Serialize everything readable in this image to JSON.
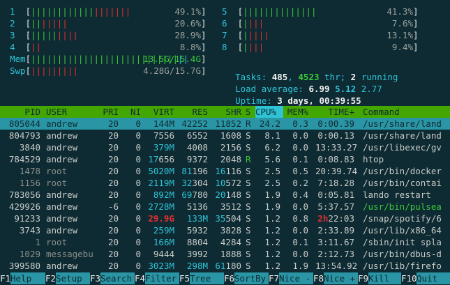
{
  "cpus": [
    {
      "id": "1",
      "pct": "49.1%",
      "bars": "|||||||||||||||||||",
      "green": 12,
      "red": 4
    },
    {
      "id": "2",
      "pct": "20.6%",
      "bars": "|||||||",
      "green": 2,
      "red": 5
    },
    {
      "id": "3",
      "pct": "28.9%",
      "bars": "|||||||||",
      "green": 5,
      "red": 4
    },
    {
      "id": "4",
      "pct": "8.8%",
      "bars": "||",
      "green": 0,
      "red": 2
    },
    {
      "id": "5",
      "pct": "41.3%",
      "bars": "||||||||||||||",
      "green": 0,
      "red": 0
    },
    {
      "id": "6",
      "pct": "7.6%",
      "bars": "||||",
      "green": 1,
      "red": 3
    },
    {
      "id": "7",
      "pct": "13.1%",
      "bars": "|||||",
      "green": 1,
      "red": 4
    },
    {
      "id": "8",
      "pct": "9.4%",
      "bars": "||||",
      "green": 1,
      "red": 3
    }
  ],
  "mem": {
    "label": "Mem",
    "value": "13.5G/15.4G",
    "level": 0.877
  },
  "swp": {
    "label": "Swp",
    "value": "4.28G/15.7G",
    "level": 0.273
  },
  "tasks": {
    "label": "Tasks:",
    "count": "485",
    "sep1": ",",
    "thr": "4523",
    "thr_label": "thr;",
    "running": "2",
    "running_label": "running"
  },
  "load": {
    "label": "Load average:",
    "v1": "6.99",
    "v2": "5.12",
    "v3": "2.77"
  },
  "uptime": {
    "label": "Uptime:",
    "value": "3 days, 00:39:55"
  },
  "columns": {
    "pid": "PID",
    "user": "USER",
    "pri": "PRI",
    "ni": "NI",
    "virt": "VIRT",
    "res": "RES",
    "shr": "SHR",
    "s": "S",
    "cpu": "CPU%",
    "mem": "MEM%",
    "time": "TIME+",
    "command": "Command"
  },
  "processes": [
    {
      "pid": "805044",
      "user": "andrew",
      "pri": "20",
      "ni": "0",
      "virt": "144M",
      "res": "42252",
      "shr": "11852",
      "s": "R",
      "cpu": "24.2",
      "mem": "0.3",
      "time": "0:00.39",
      "command": "/usr/share/land"
    },
    {
      "pid": "804793",
      "user": "andrew",
      "pri": "20",
      "ni": "0",
      "virt": "7556",
      "res": "6552",
      "shr": "1608",
      "s": "S",
      "cpu": "8.1",
      "mem": "0.0",
      "time": "0:00.13",
      "command": "/usr/share/land"
    },
    {
      "pid": "3840",
      "user": "andrew",
      "pri": "20",
      "ni": "0",
      "virt": "379M",
      "res": "4008",
      "shr": "2156",
      "s": "S",
      "cpu": "6.2",
      "mem": "0.0",
      "time": "13:33.27",
      "command": "/usr/libexec/gv"
    },
    {
      "pid": "784529",
      "user": "andrew",
      "pri": "20",
      "ni": "0",
      "virt": "17656",
      "res": "9372",
      "shr": "2048",
      "s": "R",
      "cpu": "5.6",
      "mem": "0.1",
      "time": "0:08.83",
      "command": "htop"
    },
    {
      "pid": "1478",
      "user": "root",
      "pri": "20",
      "ni": "0",
      "virt": "5020M",
      "res": "81196",
      "shr": "16116",
      "s": "S",
      "cpu": "2.5",
      "mem": "0.5",
      "time": "20:39.74",
      "command": "/usr/bin/docker"
    },
    {
      "pid": "1156",
      "user": "root",
      "pri": "20",
      "ni": "0",
      "virt": "2119M",
      "res": "32304",
      "shr": "10572",
      "s": "S",
      "cpu": "2.5",
      "mem": "0.2",
      "time": "7:18.28",
      "command": "/usr/bin/contai"
    },
    {
      "pid": "783056",
      "user": "andrew",
      "pri": "20",
      "ni": "0",
      "virt": "892M",
      "res": "69780",
      "shr": "20148",
      "s": "S",
      "cpu": "1.9",
      "mem": "0.4",
      "time": "0:05.81",
      "command": "lando restart"
    },
    {
      "pid": "429926",
      "user": "andrew",
      "pri": "-6",
      "ni": "0",
      "virt": "2728M",
      "res": "5136",
      "shr": "3512",
      "s": "S",
      "cpu": "1.9",
      "mem": "0.0",
      "time": "5:37.57",
      "command": "/usr/bin/pulsea"
    },
    {
      "pid": "91233",
      "user": "andrew",
      "pri": "20",
      "ni": "0",
      "virt": "29.9G",
      "res": "133M",
      "shr": "35504",
      "s": "S",
      "cpu": "1.2",
      "mem": "0.8",
      "time": "2h22:03",
      "command": "/snap/spotify/6"
    },
    {
      "pid": "3743",
      "user": "andrew",
      "pri": "20",
      "ni": "0",
      "virt": "259M",
      "res": "5932",
      "shr": "3828",
      "s": "S",
      "cpu": "1.2",
      "mem": "0.0",
      "time": "2:33.89",
      "command": "/usr/lib/x86_64"
    },
    {
      "pid": "1",
      "user": "root",
      "pri": "20",
      "ni": "0",
      "virt": "166M",
      "res": "8804",
      "shr": "4284",
      "s": "S",
      "cpu": "1.2",
      "mem": "0.1",
      "time": "3:11.67",
      "command": "/sbin/init spla"
    },
    {
      "pid": "1029",
      "user": "messagebu",
      "pri": "20",
      "ni": "0",
      "virt": "9444",
      "res": "3992",
      "shr": "1888",
      "s": "S",
      "cpu": "1.2",
      "mem": "0.0",
      "time": "2:12.73",
      "command": "/usr/bin/dbus-d"
    },
    {
      "pid": "399580",
      "user": "andrew",
      "pri": "20",
      "ni": "0",
      "virt": "3023M",
      "res": "298M",
      "shr": "61180",
      "s": "S",
      "cpu": "1.2",
      "mem": "1.9",
      "time": "13:54.92",
      "command": "/usr/lib/firefo"
    }
  ],
  "footer": [
    {
      "key": "F1",
      "label": "Help  "
    },
    {
      "key": "F2",
      "label": "Setup "
    },
    {
      "key": "F3",
      "label": "Search"
    },
    {
      "key": "F4",
      "label": "Filter"
    },
    {
      "key": "F5",
      "label": "Tree  "
    },
    {
      "key": "F6",
      "label": "SortBy"
    },
    {
      "key": "F7",
      "label": "Nice -"
    },
    {
      "key": "F8",
      "label": "Nice +"
    },
    {
      "key": "F9",
      "label": "Kill  "
    },
    {
      "key": "F10",
      "label": "Quit  "
    }
  ],
  "colors": {
    "bg": "#0e2a33",
    "cyan": "#2ec4d6",
    "green": "#3cc93c",
    "red": "#e03030",
    "header": "#44a600",
    "selected": "#2a95a4"
  }
}
